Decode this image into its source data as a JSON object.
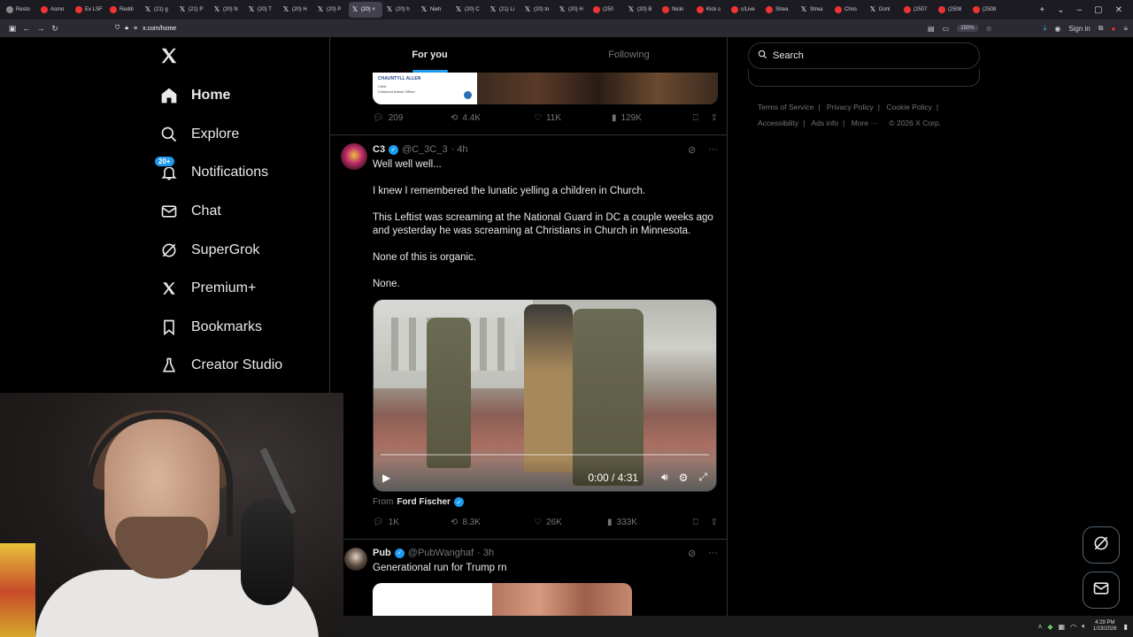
{
  "browser": {
    "tabs": [
      {
        "label": "Resto",
        "fav": "clock-icon"
      },
      {
        "label": "Asmo",
        "fav": "red"
      },
      {
        "label": "Ex LSF",
        "fav": "red"
      },
      {
        "label": "Reddi",
        "fav": "red"
      },
      {
        "label": "(21) g",
        "fav": "x"
      },
      {
        "label": "(21) P",
        "fav": "x"
      },
      {
        "label": "(20) N",
        "fav": "x"
      },
      {
        "label": "(20) T",
        "fav": "x"
      },
      {
        "label": "(20) H",
        "fav": "x"
      },
      {
        "label": "(20) P",
        "fav": "x"
      },
      {
        "label": "(20) ×",
        "fav": "x",
        "active": true
      },
      {
        "label": "(20) h",
        "fav": "x"
      },
      {
        "label": "Nieh",
        "fav": "x"
      },
      {
        "label": "(20) C",
        "fav": "x"
      },
      {
        "label": "(21) Li",
        "fav": "x"
      },
      {
        "label": "(20) to",
        "fav": "x"
      },
      {
        "label": "(20) H",
        "fav": "x"
      },
      {
        "label": "(250",
        "fav": "red"
      },
      {
        "label": "(20) B",
        "fav": "x"
      },
      {
        "label": "Nicki",
        "fav": "red"
      },
      {
        "label": "Kick s",
        "fav": "red"
      },
      {
        "label": "c/Live",
        "fav": "red"
      },
      {
        "label": "Strea",
        "fav": "red"
      },
      {
        "label": "Strea",
        "fav": "x"
      },
      {
        "label": "Chris",
        "fav": "red"
      },
      {
        "label": "Donl",
        "fav": "x"
      },
      {
        "label": "(2507",
        "fav": "red"
      },
      {
        "label": "(2508",
        "fav": "red"
      },
      {
        "label": "(2508",
        "fav": "red"
      }
    ],
    "url": "x.com/home",
    "zoom": "150%",
    "sign_in": "Sign in"
  },
  "nav": {
    "logo": "X",
    "items": [
      {
        "label": "Home",
        "icon": "home-icon",
        "active": true
      },
      {
        "label": "Explore",
        "icon": "search-icon"
      },
      {
        "label": "Notifications",
        "icon": "bell-icon",
        "badge": "20+"
      },
      {
        "label": "Chat",
        "icon": "mail-icon"
      },
      {
        "label": "SuperGrok",
        "icon": "grok-icon"
      },
      {
        "label": "Premium+",
        "icon": "x-logo-icon"
      },
      {
        "label": "Bookmarks",
        "icon": "bookmark-icon"
      },
      {
        "label": "Creator Studio",
        "icon": "flask-icon"
      }
    ]
  },
  "feed": {
    "tabs": [
      "For you",
      "Following"
    ],
    "prev_post": {
      "card_name": "CHAUNTYLL ALLEN",
      "card_title": "Clerk",
      "card_sub": "Cobianca Admin Officer",
      "replies": "209",
      "reposts": "4.4K",
      "likes": "11K",
      "views": "129K"
    },
    "post1": {
      "name": "C3",
      "handle": "@C_3C_3",
      "time": "· 4h",
      "lines": [
        "Well well well...",
        "I knew I remembered the lunatic yelling a children in Church.",
        "This Leftist was screaming at the National Guard in DC a couple weeks ago and yesterday he was screaming at Christians in Church in Minnesota.",
        "None of this is organic.",
        "None."
      ],
      "video_time": "0:00 / 4:31",
      "from_label": "From",
      "from_name": "Ford Fischer",
      "replies": "1K",
      "reposts": "8.3K",
      "likes": "26K",
      "views": "333K"
    },
    "post2": {
      "name": "Pub",
      "handle": "@PubWanghaf",
      "time": "· 3h",
      "text": "Generational run for Trump rn"
    }
  },
  "sidebar": {
    "search_placeholder": "Search",
    "footer": [
      "Terms of Service",
      "Privacy Policy",
      "Cookie Policy",
      "Accessibility",
      "Ads info",
      "More ···",
      "© 2026 X Corp."
    ]
  },
  "taskbar": {
    "time": "4:29 PM",
    "date": "1/19/2026"
  },
  "colors": {
    "accent": "#1d9bf0",
    "bg": "#000000",
    "muted": "#71767b",
    "border": "#2f3336"
  }
}
